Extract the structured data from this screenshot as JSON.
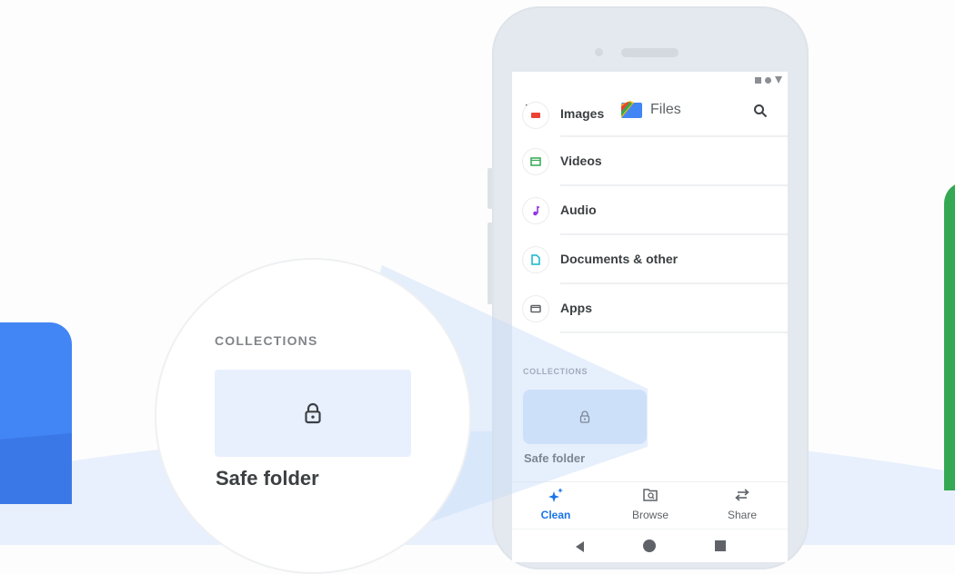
{
  "app": {
    "title": "Files",
    "menu_icon": "hamburger-menu-icon",
    "search_icon": "search-icon"
  },
  "status_bar": {
    "icons": [
      "signal-square-icon",
      "dot-icon",
      "wifi-triangle-icon"
    ]
  },
  "categories": [
    {
      "label": "Images",
      "icon": "image-icon",
      "color": "#ea4335"
    },
    {
      "label": "Videos",
      "icon": "video-icon",
      "color": "#34a853"
    },
    {
      "label": "Audio",
      "icon": "music-note-icon",
      "color": "#9334e6"
    },
    {
      "label": "Documents & other",
      "icon": "document-icon",
      "color": "#12b5cb"
    },
    {
      "label": "Apps",
      "icon": "app-window-icon",
      "color": "#5f6368"
    }
  ],
  "collections": {
    "heading": "COLLECTIONS",
    "items": [
      {
        "label": "Safe folder",
        "icon": "lock-icon"
      }
    ]
  },
  "zoom_callout": {
    "heading": "COLLECTIONS",
    "item_label": "Safe folder",
    "icon": "lock-icon"
  },
  "bottom_nav": [
    {
      "label": "Clean",
      "icon": "sparkle-icon",
      "active": true
    },
    {
      "label": "Browse",
      "icon": "folder-search-icon",
      "active": false
    },
    {
      "label": "Share",
      "icon": "swap-arrows-icon",
      "active": false
    }
  ],
  "system_nav": [
    "back-icon",
    "home-icon",
    "recents-icon"
  ],
  "colors": {
    "accent": "#1a73e8",
    "card_bg": "#d2e3fc",
    "decor_blue": "#4285f4",
    "decor_green": "#34a853",
    "wave": "#e8f0fd",
    "phone_frame": "#e4e8ef"
  }
}
